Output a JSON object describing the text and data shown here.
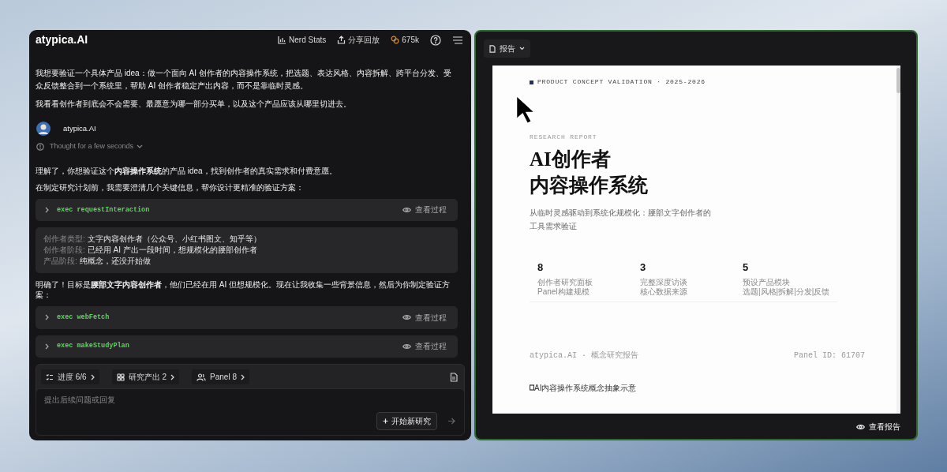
{
  "app": {
    "logo": "atypica.AI",
    "header_actions": [
      {
        "kind": "stats",
        "label": "Nerd Stats"
      },
      {
        "kind": "share",
        "label": "分享回放"
      },
      {
        "kind": "tokens",
        "label": "675k"
      },
      {
        "kind": "help"
      },
      {
        "kind": "menu"
      }
    ]
  },
  "chat": [
    {
      "kind": "user",
      "paragraphs": [
        "我想要验证一个具体产品 idea：做一个面向 AI 创作者的内容操作系统，把选题、表达风格、内容拆解、跨平台分发、受众反馈整合到一个系统里，帮助 AI 创作者稳定产出内容，而不是靠临时灵感。",
        "我看看创作者到底会不会需要、最愿意为哪一部分买单，以及这个产品应该从哪里切进去。"
      ]
    },
    {
      "kind": "assistant",
      "name": "atypica.AI",
      "thought": "Thought for a few seconds"
    },
    {
      "kind": "text",
      "text": "理解了，你想验证这个**内容操作系统**的产品 idea，找到创作者的真实需求和付费意愿。"
    },
    {
      "kind": "text",
      "text": "在制定研究计划前，我需要澄清几个关键信息，帮你设计更精准的验证方案："
    },
    {
      "kind": "tool",
      "command": "exec requestInteraction",
      "action": "查看过程"
    },
    {
      "kind": "answers",
      "rows": [
        {
          "label": "创作者类型:",
          "value": "文字内容创作者（公众号、小红书图文、知乎等）"
        },
        {
          "label": "创作者阶段:",
          "value": "已经用 AI 产出一段时间，想规模化的腰部创作者"
        },
        {
          "label": "产品阶段:",
          "value": "纯概念，还没开始做"
        }
      ]
    },
    {
      "kind": "text",
      "text": "明确了！目标是**腰部文字内容创作者**，他们已经在用 AI 但想规模化。现在让我收集一些背景信息，然后为你制定验证方案："
    },
    {
      "kind": "tool",
      "command": "exec webFetch",
      "action": "查看过程"
    },
    {
      "kind": "tool",
      "command": "exec makeStudyPlan",
      "action": "查看过程"
    }
  ],
  "status_chips": [
    {
      "kind": "progress",
      "label": "进度",
      "count": "6/6"
    },
    {
      "kind": "outputs",
      "label": "研究产出",
      "count": "2"
    },
    {
      "kind": "panel",
      "label": "Panel",
      "count": "8"
    }
  ],
  "composer": {
    "placeholder": "提出后续问题或回复",
    "new_button": "开始新研究"
  },
  "report_panel": {
    "tab": "报告",
    "eyebrow": "PRODUCT CONCEPT VALIDATION · 2025-2026",
    "kicker": "RESEARCH REPORT",
    "title_lines": [
      "AI创作者",
      "内容操作系统"
    ],
    "subtitle": "从临时灵感驱动到系统化规模化：腰部文字创作者的工具需求验证",
    "stats": [
      {
        "value": "8",
        "lines": [
          "创作者研究面板",
          "Panel构建规模"
        ]
      },
      {
        "value": "3",
        "lines": [
          "完整深度访谈",
          "核心数据来源"
        ]
      },
      {
        "value": "5",
        "lines": [
          "预设产品模块",
          "选题|风格|拆解|分发|反馈"
        ]
      }
    ],
    "footer_left": "atypica.AI · 概念研究报告",
    "footer_right": "Panel ID: 61707",
    "image_alt": "AI内容操作系统概念抽象示意",
    "view_button": "查看报告"
  }
}
